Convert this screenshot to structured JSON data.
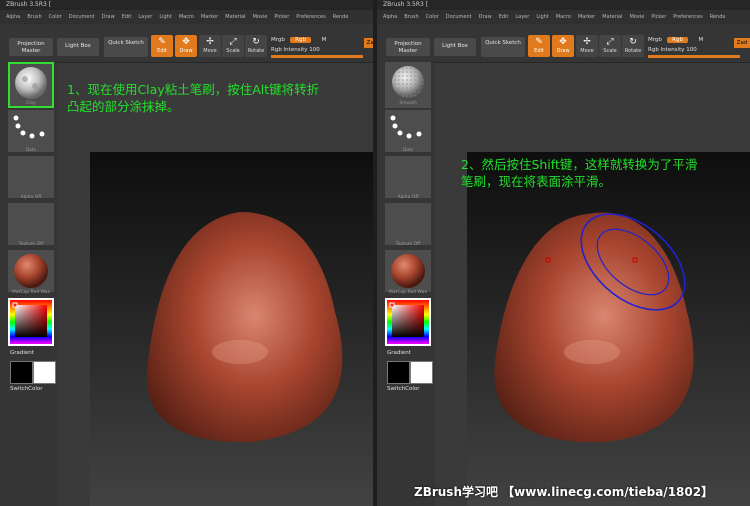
{
  "app": {
    "title": "ZBrush 3.5R3 ["
  },
  "menu": [
    "Alpha",
    "Brush",
    "Color",
    "Document",
    "Draw",
    "Edit",
    "Layer",
    "Light",
    "Macro",
    "Marker",
    "Material",
    "Movie",
    "Picker",
    "Preferences",
    "Rende"
  ],
  "toolbar": {
    "projection_master": "Projection Master",
    "light_box": "Light Box",
    "quick_sketch": "Quick Sketch",
    "edit": "Edit",
    "draw": "Draw",
    "move": "Move",
    "scale": "Scale",
    "rotate": "Rotate",
    "mrgb": "Mrgb",
    "rgb": "Rgb",
    "m": "M",
    "rgb_intensity_label": "Rgb Intensity",
    "rgb_intensity_value": "100",
    "rgb_intensity_fraction": 1.0,
    "zadd": "Zad"
  },
  "sidebar": {
    "left_brush_label": "Clay",
    "right_brush_label": "Smooth",
    "stroke_label": "Dots",
    "alpha_label": "Alpha Off",
    "texture_label": "Texture Off",
    "material_label": "MatCap Red Wax",
    "gradient_label": "Gradient",
    "switch_color_label": "SwitchColor"
  },
  "notes": {
    "step1": [
      "1、现在使用Clay粘土笔刷，按住Alt键将转折",
      "凸起的部分涂抹掉。"
    ],
    "step2": [
      "2、然后按住Shift键，这样就转换为了平滑",
      "笔刷，现在将表面涂平滑。"
    ]
  },
  "footer": "ZBrush学习吧 【www.linecg.com/tieba/1802】",
  "colors": {
    "accent": "#e07a1c",
    "note_green": "#22e02a",
    "clay": "#a8452f",
    "brush_circle": "#2222cc"
  }
}
